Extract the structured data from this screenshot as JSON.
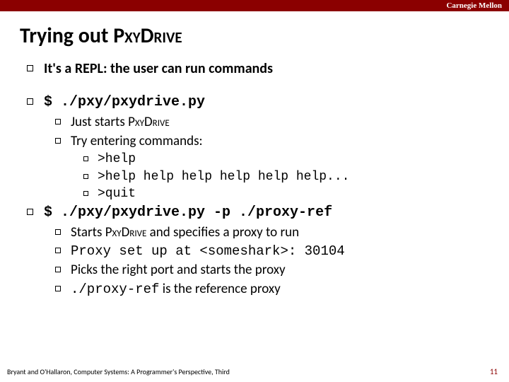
{
  "header": {
    "org": "Carnegie Mellon"
  },
  "title": {
    "prefix": "Trying out ",
    "brand": "PxyDrive"
  },
  "bullets": {
    "repl": "It's a REPL: the user can run commands",
    "cmd1": "$ ./pxy/pxydrive.py",
    "cmd1_sub": {
      "starts_prefix": "Just starts ",
      "starts_brand": "PxyDrive",
      "try": "Try entering commands:",
      "help": ">help",
      "helpmany": ">help help help help help help...",
      "quit": ">quit"
    },
    "cmd2": "$ ./pxy/pxydrive.py -p ./proxy-ref",
    "cmd2_sub": {
      "starts_prefix": "Starts ",
      "starts_brand": "PxyDrive",
      "starts_suffix": " and specifies a proxy to run",
      "setup": "Proxy set up at <someshark>: 30104",
      "picks": "Picks the right port and starts the proxy",
      "ref_code": "./proxy-ref",
      "ref_suffix": " is the reference proxy"
    }
  },
  "footer": {
    "attribution": "Bryant and O'Hallaron, Computer Systems: A Programmer's Perspective, Third",
    "page": "11"
  }
}
